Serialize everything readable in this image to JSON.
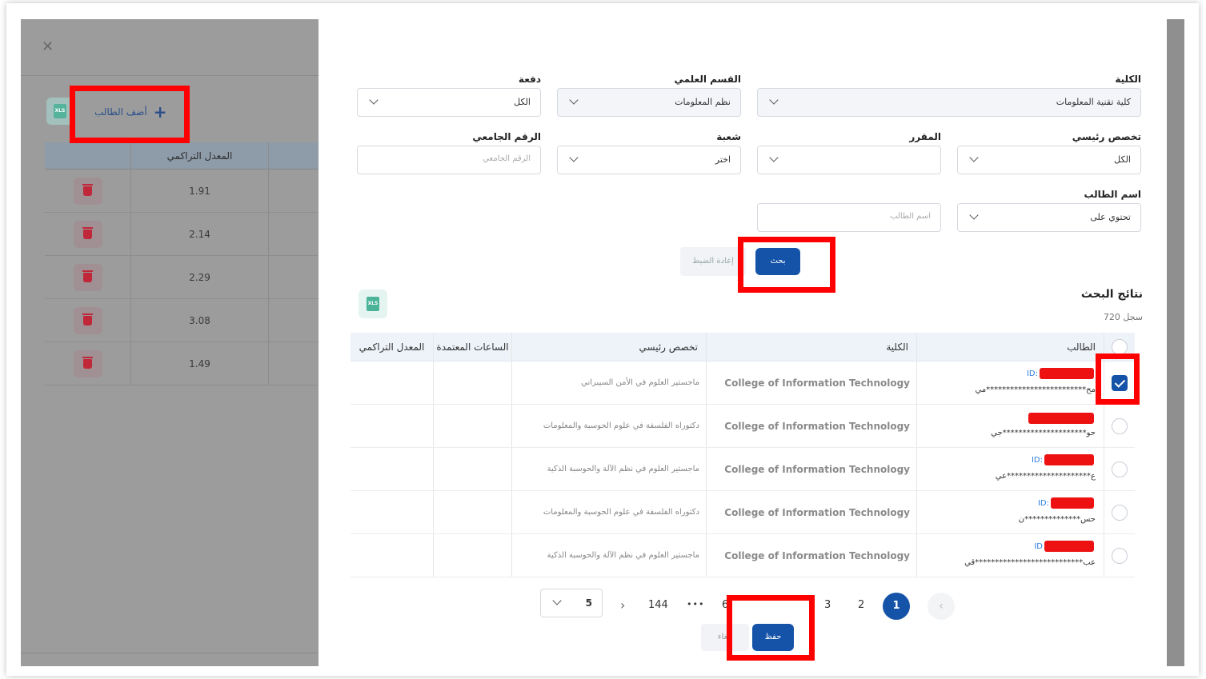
{
  "left_panel": {
    "close_glyph": "✕",
    "add_student_label": "أضف الطالب",
    "column_cgpa": "المعدل التراكمي",
    "rows": [
      {
        "cgpa": "1.91"
      },
      {
        "cgpa": "2.14"
      },
      {
        "cgpa": "2.29"
      },
      {
        "cgpa": "3.08"
      },
      {
        "cgpa": "1.49"
      }
    ]
  },
  "filters": {
    "college": {
      "label": "الكلية",
      "value": "كلية تقنية المعلومات"
    },
    "department": {
      "label": "القسم العلمي",
      "value": "نظم المعلومات"
    },
    "batch": {
      "label": "دفعة",
      "value": "الكل"
    },
    "major": {
      "label": "تخصص رئيسي",
      "value": "الكل"
    },
    "course": {
      "label": "المقرر",
      "value": ""
    },
    "section": {
      "label": "شعبة",
      "value": "اختر"
    },
    "university_id": {
      "label": "الرقم الجامعي",
      "placeholder": "الرقم الجامعي"
    },
    "name_operator": {
      "label": "اسم الطالب",
      "value": "تحتوي على"
    },
    "name_input": {
      "placeholder": "اسم الطالب"
    }
  },
  "actions": {
    "reset": "إعادة الضبط",
    "search": "بحث"
  },
  "results": {
    "title": "نتائج البحث",
    "count": "720 سجل",
    "columns": {
      "student": "الطالب",
      "college": "الكلية",
      "major": "تخصص رئيسي",
      "hours": "الساعات المعتمدة",
      "cgpa": "المعدل التراكمي"
    },
    "rows": [
      {
        "id_prefix": "ID:",
        "name": "مح*************************مي",
        "college": "College of Information Technology",
        "major": "ماجستير العلوم في الأمن السيبراني",
        "checked": true
      },
      {
        "id_prefix": "",
        "name": "حو*********************جي",
        "college": "College of Information Technology",
        "major": "دكتوراه الفلسفة في علوم الحوسبة والمعلومات",
        "checked": false
      },
      {
        "id_prefix": "ID:",
        "name": "ع*********************عي",
        "college": "College of Information Technology",
        "major": "ماجستير العلوم في نظم الآلة والحوسبة الذكية",
        "checked": false
      },
      {
        "id_prefix": "ID:",
        "name": "حس**************ن",
        "college": "College of Information Technology",
        "major": "دكتوراه الفلسفة في علوم الحوسبة والمعلومات",
        "checked": false
      },
      {
        "id_prefix": "ID",
        "name": "عب***************************قي",
        "college": "College of Information Technology",
        "major": "ماجستير العلوم في نظم الآلة والحوسبة الذكية",
        "checked": false
      }
    ]
  },
  "pagination": {
    "pages": [
      "1",
      "2",
      "3",
      "6"
    ],
    "ellipsis": "•••",
    "last": "144",
    "next_glyph": "›",
    "prev_glyph": "‹",
    "page_size": "5"
  },
  "footer": {
    "cancel": "إلغاء",
    "save": "حفظ"
  },
  "colors": {
    "primary": "#1553a8",
    "highlight": "#ff0000",
    "danger": "#c0283a"
  }
}
